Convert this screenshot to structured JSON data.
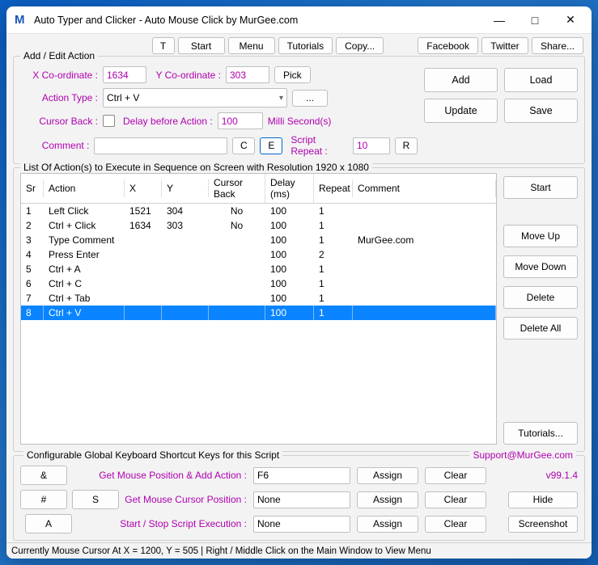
{
  "window": {
    "title": "Auto Typer and Clicker - Auto Mouse Click by MurGee.com"
  },
  "topbar": {
    "t": "T",
    "start": "Start",
    "menu": "Menu",
    "tutorials": "Tutorials",
    "copy": "Copy...",
    "facebook": "Facebook",
    "twitter": "Twitter",
    "share": "Share..."
  },
  "addEdit": {
    "legend": "Add / Edit Action",
    "x_label": "X Co-ordinate :",
    "x_value": "1634",
    "y_label": "Y Co-ordinate :",
    "y_value": "303",
    "pick": "Pick",
    "action_type_label": "Action Type :",
    "action_type_value": "Ctrl + V",
    "ellipsis": "...",
    "cursor_back_label": "Cursor Back :",
    "delay_label": "Delay before Action :",
    "delay_value": "100",
    "delay_unit": "Milli Second(s)",
    "comment_label": "Comment :",
    "c_btn": "C",
    "e_btn": "E",
    "script_repeat_label": "Script Repeat :",
    "script_repeat_value": "10",
    "r_btn": "R",
    "add": "Add",
    "load": "Load",
    "update": "Update",
    "save": "Save"
  },
  "list": {
    "title": "List Of Action(s) to Execute in Sequence on Screen with Resolution 1920 x 1080",
    "headers": {
      "sr": "Sr",
      "action": "Action",
      "x": "X",
      "y": "Y",
      "cursor": "Cursor Back",
      "delay": "Delay (ms)",
      "repeat": "Repeat",
      "comment": "Comment"
    },
    "rows": [
      {
        "sr": "1",
        "action": "Left Click",
        "x": "1521",
        "y": "304",
        "cursor": "No",
        "delay": "100",
        "repeat": "1",
        "comment": ""
      },
      {
        "sr": "2",
        "action": "Ctrl + Click",
        "x": "1634",
        "y": "303",
        "cursor": "No",
        "delay": "100",
        "repeat": "1",
        "comment": ""
      },
      {
        "sr": "3",
        "action": "Type Comment",
        "x": "",
        "y": "",
        "cursor": "",
        "delay": "100",
        "repeat": "1",
        "comment": "MurGee.com"
      },
      {
        "sr": "4",
        "action": "Press Enter",
        "x": "",
        "y": "",
        "cursor": "",
        "delay": "100",
        "repeat": "2",
        "comment": ""
      },
      {
        "sr": "5",
        "action": "Ctrl + A",
        "x": "",
        "y": "",
        "cursor": "",
        "delay": "100",
        "repeat": "1",
        "comment": ""
      },
      {
        "sr": "6",
        "action": "Ctrl + C",
        "x": "",
        "y": "",
        "cursor": "",
        "delay": "100",
        "repeat": "1",
        "comment": ""
      },
      {
        "sr": "7",
        "action": "Ctrl + Tab",
        "x": "",
        "y": "",
        "cursor": "",
        "delay": "100",
        "repeat": "1",
        "comment": ""
      },
      {
        "sr": "8",
        "action": "Ctrl + V",
        "x": "",
        "y": "",
        "cursor": "",
        "delay": "100",
        "repeat": "1",
        "comment": ""
      }
    ],
    "selected_index": 7
  },
  "sidebtns": {
    "start": "Start",
    "moveup": "Move Up",
    "movedown": "Move Down",
    "delete": "Delete",
    "deleteall": "Delete All",
    "tutorials": "Tutorials..."
  },
  "shortcuts": {
    "legend": "Configurable Global Keyboard Shortcut Keys for this Script",
    "support": "Support@MurGee.com",
    "amp": "&",
    "hash": "#",
    "s": "S",
    "a": "A",
    "row1_label": "Get Mouse Position & Add Action :",
    "row1_value": "F6",
    "row2_label": "Get Mouse Cursor Position :",
    "row2_value": "None",
    "row3_label": "Start / Stop Script Execution :",
    "row3_value": "None",
    "assign": "Assign",
    "clear": "Clear",
    "version": "v99.1.4",
    "hide": "Hide",
    "screenshot": "Screenshot"
  },
  "status": "Currently Mouse Cursor At X = 1200, Y = 505 | Right / Middle Click on the Main Window to View Menu"
}
